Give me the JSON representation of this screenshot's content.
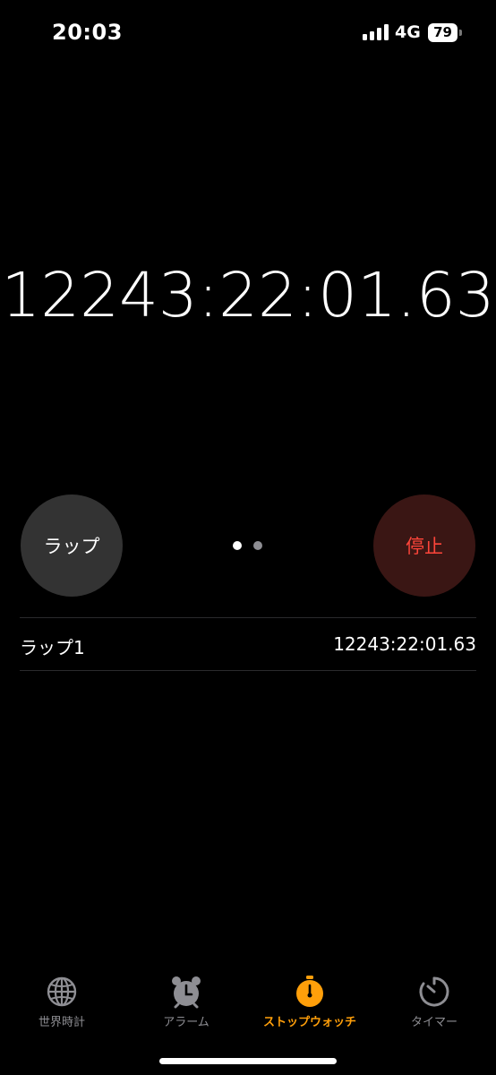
{
  "status_bar": {
    "time": "20:03",
    "network": "4G",
    "battery": "79"
  },
  "stopwatch": {
    "main_time": "12243:22:01.63",
    "lap_button_label": "ラップ",
    "stop_button_label": "停止",
    "page_index": 1,
    "page_count": 2
  },
  "laps": [
    {
      "name": "ラップ1",
      "time": "12243:22:01.63"
    }
  ],
  "tab_bar": {
    "tabs": [
      {
        "label": "世界時計",
        "icon": "globe-icon",
        "active": false
      },
      {
        "label": "アラーム",
        "icon": "alarm-clock-icon",
        "active": false
      },
      {
        "label": "ストップウォッチ",
        "icon": "stopwatch-icon",
        "active": true
      },
      {
        "label": "タイマー",
        "icon": "timer-icon",
        "active": false
      }
    ]
  },
  "colors": {
    "accent": "#ff9f0a",
    "stop_text": "#ff453a",
    "stop_bg": "#3a1614",
    "lap_bg": "#333333",
    "inactive_tab": "#8e8e93"
  }
}
